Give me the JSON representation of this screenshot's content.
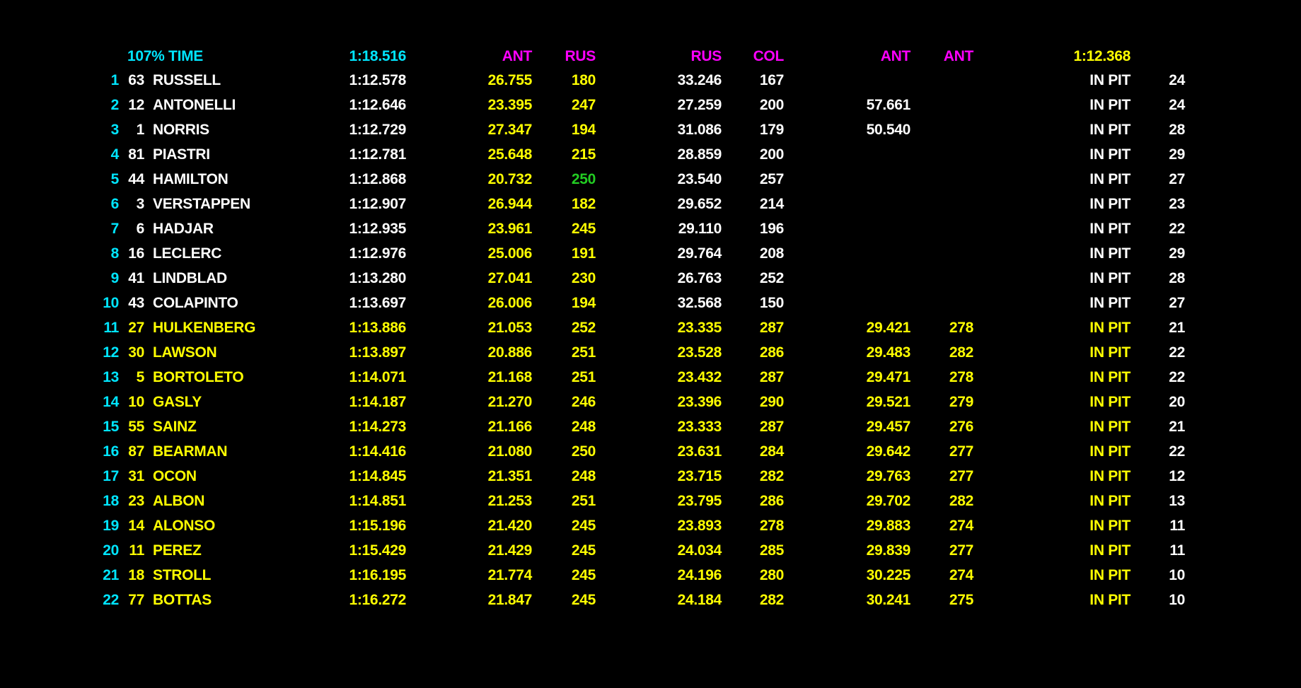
{
  "colors": {
    "background": "#000000",
    "white": "#ffffff",
    "yellow": "#ffff00",
    "magenta": "#ff00ff",
    "cyan": "#00e5ff",
    "green": "#22cc22"
  },
  "header": {
    "label": "107% TIME",
    "lap_time": "1:18.516",
    "s1_best": "ANT",
    "sp1_best": "RUS",
    "s2_best": "RUS",
    "sp2_best": "COL",
    "s3_best": "ANT",
    "sp3_best": "ANT",
    "best_lap": "1:12.368"
  },
  "rows": [
    {
      "pos": "1",
      "num": "63",
      "name": "RUSSELL",
      "lap": "1:12.578",
      "s1": "26.755",
      "sp1": "180",
      "s2": "33.246",
      "sp2": "167",
      "s3": "",
      "sp3": "",
      "pit": "IN PIT",
      "laps": "24"
    },
    {
      "pos": "2",
      "num": "12",
      "name": "ANTONELLI",
      "lap": "1:12.646",
      "s1": "23.395",
      "sp1": "247",
      "s2": "27.259",
      "sp2": "200",
      "s3": "57.661",
      "sp3": "",
      "pit": "IN PIT",
      "laps": "24"
    },
    {
      "pos": "3",
      "num": "1",
      "name": "NORRIS",
      "lap": "1:12.729",
      "s1": "27.347",
      "sp1": "194",
      "s2": "31.086",
      "sp2": "179",
      "s3": "50.540",
      "sp3": "",
      "pit": "IN PIT",
      "laps": "28"
    },
    {
      "pos": "4",
      "num": "81",
      "name": "PIASTRI",
      "lap": "1:12.781",
      "s1": "25.648",
      "sp1": "215",
      "s2": "28.859",
      "sp2": "200",
      "s3": "",
      "sp3": "",
      "pit": "IN PIT",
      "laps": "29"
    },
    {
      "pos": "5",
      "num": "44",
      "name": "HAMILTON",
      "lap": "1:12.868",
      "s1": "20.732",
      "sp1": "250",
      "s2": "23.540",
      "sp2": "257",
      "s3": "",
      "sp3": "",
      "pit": "IN PIT",
      "laps": "27"
    },
    {
      "pos": "6",
      "num": "3",
      "name": "VERSTAPPEN",
      "lap": "1:12.907",
      "s1": "26.944",
      "sp1": "182",
      "s2": "29.652",
      "sp2": "214",
      "s3": "",
      "sp3": "",
      "pit": "IN PIT",
      "laps": "23"
    },
    {
      "pos": "7",
      "num": "6",
      "name": "HADJAR",
      "lap": "1:12.935",
      "s1": "23.961",
      "sp1": "245",
      "s2": "29.110",
      "sp2": "196",
      "s3": "",
      "sp3": "",
      "pit": "IN PIT",
      "laps": "22"
    },
    {
      "pos": "8",
      "num": "16",
      "name": "LECLERC",
      "lap": "1:12.976",
      "s1": "25.006",
      "sp1": "191",
      "s2": "29.764",
      "sp2": "208",
      "s3": "",
      "sp3": "",
      "pit": "IN PIT",
      "laps": "29"
    },
    {
      "pos": "9",
      "num": "41",
      "name": "LINDBLAD",
      "lap": "1:13.280",
      "s1": "27.041",
      "sp1": "230",
      "s2": "26.763",
      "sp2": "252",
      "s3": "",
      "sp3": "",
      "pit": "IN PIT",
      "laps": "28"
    },
    {
      "pos": "10",
      "num": "43",
      "name": "COLAPINTO",
      "lap": "1:13.697",
      "s1": "26.006",
      "sp1": "194",
      "s2": "32.568",
      "sp2": "150",
      "s3": "",
      "sp3": "",
      "pit": "IN PIT",
      "laps": "27"
    },
    {
      "pos": "11",
      "num": "27",
      "name": "HULKENBERG",
      "lap": "1:13.886",
      "s1": "21.053",
      "sp1": "252",
      "s2": "23.335",
      "sp2": "287",
      "s3": "29.421",
      "sp3": "278",
      "pit": "IN PIT",
      "laps": "21"
    },
    {
      "pos": "12",
      "num": "30",
      "name": "LAWSON",
      "lap": "1:13.897",
      "s1": "20.886",
      "sp1": "251",
      "s2": "23.528",
      "sp2": "286",
      "s3": "29.483",
      "sp3": "282",
      "pit": "IN PIT",
      "laps": "22"
    },
    {
      "pos": "13",
      "num": "5",
      "name": "BORTOLETO",
      "lap": "1:14.071",
      "s1": "21.168",
      "sp1": "251",
      "s2": "23.432",
      "sp2": "287",
      "s3": "29.471",
      "sp3": "278",
      "pit": "IN PIT",
      "laps": "22"
    },
    {
      "pos": "14",
      "num": "10",
      "name": "GASLY",
      "lap": "1:14.187",
      "s1": "21.270",
      "sp1": "246",
      "s2": "23.396",
      "sp2": "290",
      "s3": "29.521",
      "sp3": "279",
      "pit": "IN PIT",
      "laps": "20"
    },
    {
      "pos": "15",
      "num": "55",
      "name": "SAINZ",
      "lap": "1:14.273",
      "s1": "21.166",
      "sp1": "248",
      "s2": "23.333",
      "sp2": "287",
      "s3": "29.457",
      "sp3": "276",
      "pit": "IN PIT",
      "laps": "21"
    },
    {
      "pos": "16",
      "num": "87",
      "name": "BEARMAN",
      "lap": "1:14.416",
      "s1": "21.080",
      "sp1": "250",
      "s2": "23.631",
      "sp2": "284",
      "s3": "29.642",
      "sp3": "277",
      "pit": "IN PIT",
      "laps": "22"
    },
    {
      "pos": "17",
      "num": "31",
      "name": "OCON",
      "lap": "1:14.845",
      "s1": "21.351",
      "sp1": "248",
      "s2": "23.715",
      "sp2": "282",
      "s3": "29.763",
      "sp3": "277",
      "pit": "IN PIT",
      "laps": "12"
    },
    {
      "pos": "18",
      "num": "23",
      "name": "ALBON",
      "lap": "1:14.851",
      "s1": "21.253",
      "sp1": "251",
      "s2": "23.795",
      "sp2": "286",
      "s3": "29.702",
      "sp3": "282",
      "pit": "IN PIT",
      "laps": "13"
    },
    {
      "pos": "19",
      "num": "14",
      "name": "ALONSO",
      "lap": "1:15.196",
      "s1": "21.420",
      "sp1": "245",
      "s2": "23.893",
      "sp2": "278",
      "s3": "29.883",
      "sp3": "274",
      "pit": "IN PIT",
      "laps": "11"
    },
    {
      "pos": "20",
      "num": "11",
      "name": "PEREZ",
      "lap": "1:15.429",
      "s1": "21.429",
      "sp1": "245",
      "s2": "24.034",
      "sp2": "285",
      "s3": "29.839",
      "sp3": "277",
      "pit": "IN PIT",
      "laps": "11"
    },
    {
      "pos": "21",
      "num": "18",
      "name": "STROLL",
      "lap": "1:16.195",
      "s1": "21.774",
      "sp1": "245",
      "s2": "24.196",
      "sp2": "280",
      "s3": "30.225",
      "sp3": "274",
      "pit": "IN PIT",
      "laps": "10"
    },
    {
      "pos": "22",
      "num": "77",
      "name": "BOTTAS",
      "lap": "1:16.272",
      "s1": "21.847",
      "sp1": "245",
      "s2": "24.184",
      "sp2": "282",
      "s3": "30.241",
      "sp3": "275",
      "pit": "IN PIT",
      "laps": "10"
    }
  ]
}
